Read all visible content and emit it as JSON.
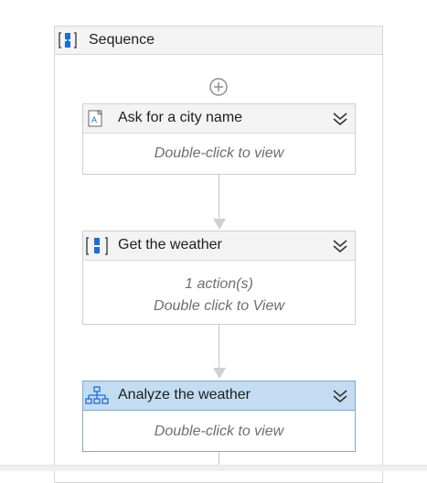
{
  "sequence": {
    "title": "Sequence",
    "icon": "sequence-icon"
  },
  "add": {
    "icon": "add-activity-icon"
  },
  "activities": [
    {
      "title": "Ask for a city name",
      "icon": "input-dialog-icon",
      "body": [
        "Double-click to view"
      ],
      "selected": false
    },
    {
      "title": "Get the weather",
      "icon": "sequence-icon",
      "body": [
        "1 action(s)",
        "Double click to View"
      ],
      "selected": false
    },
    {
      "title": "Analyze the weather",
      "icon": "flowchart-icon",
      "body": [
        "Double-click to view"
      ],
      "selected": true
    }
  ],
  "colors": {
    "header_bg": "#f3f3f3",
    "selected_header_bg": "#c3dcf1",
    "selected_border": "#7fa9cf",
    "icon_blue": "#1f6fd1",
    "body_text": "#6e6e6e"
  }
}
